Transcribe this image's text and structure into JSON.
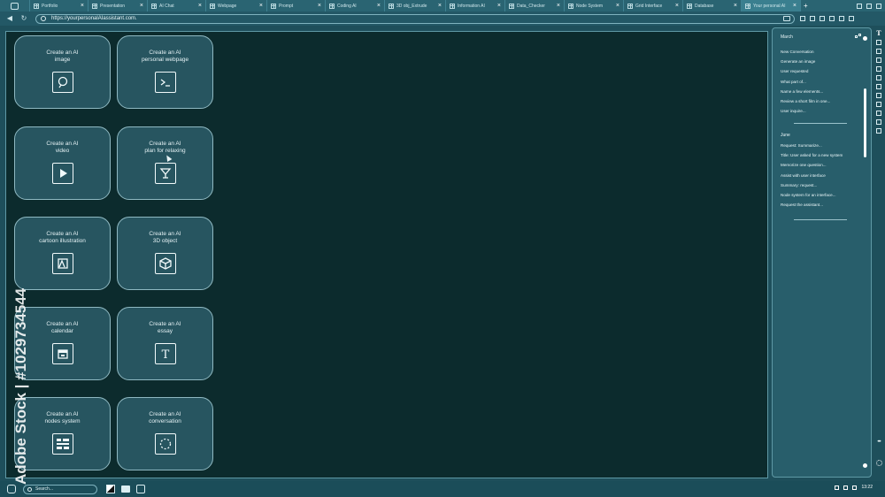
{
  "tabs": [
    {
      "label": "Portfolio",
      "active": false
    },
    {
      "label": "Presentation",
      "active": false
    },
    {
      "label": "AI Chat",
      "active": false
    },
    {
      "label": "Webpage",
      "active": false
    },
    {
      "label": "Prompt",
      "active": false
    },
    {
      "label": "Coding AI",
      "active": false
    },
    {
      "label": "3D obj_Extrude",
      "active": false
    },
    {
      "label": "Information AI",
      "active": false
    },
    {
      "label": "Data_Checker",
      "active": false
    },
    {
      "label": "Node System",
      "active": false
    },
    {
      "label": "Grid Interface",
      "active": false
    },
    {
      "label": "Database",
      "active": false
    },
    {
      "label": "Your personal AI",
      "active": true
    }
  ],
  "address": {
    "url": "https://yourpersonalAIassistant.com."
  },
  "cards": [
    {
      "title": "Create an AI\nimage",
      "icon": "image-icon"
    },
    {
      "title": "Create an AI\npersonal webpage",
      "icon": "terminal-icon"
    },
    {
      "title": "Create an AI\nvideo",
      "icon": "play-icon"
    },
    {
      "title": "Create an AI\nplan for relaxing",
      "icon": "cocktail-icon"
    },
    {
      "title": "Create an AI\ncartoon illustration",
      "icon": "illustration-icon"
    },
    {
      "title": "Create an AI\n3D object",
      "icon": "cube-icon"
    },
    {
      "title": "Create an AI\ncalendar",
      "icon": "calendar-icon"
    },
    {
      "title": "Create an AI\nessay",
      "icon": "text-icon"
    },
    {
      "title": "Create an AI\nnodes system",
      "icon": "nodes-icon"
    },
    {
      "title": "Create an AI\nconversation",
      "icon": "conversation-icon"
    }
  ],
  "sidebar": {
    "march_heading": "March",
    "march_items": [
      "New Conversation",
      "Generate an image",
      "User requested",
      "What part of...",
      "Name a few elements...",
      "Review a short film in one...",
      "User inquire..."
    ],
    "june_heading": "June",
    "june_items": [
      "Request: Summarize...",
      "Title: User asked for a new system",
      "Memorize one question...",
      "Assist with user interface",
      "Summary: request...",
      "Node system for an interface...",
      "Request the assistant..."
    ]
  },
  "right_toolbar": {
    "text_tool": "T"
  },
  "taskbar": {
    "search_placeholder": "Search...",
    "time": "13:22"
  },
  "watermark": {
    "side_text": "Adobe Stock | #1029734544"
  }
}
